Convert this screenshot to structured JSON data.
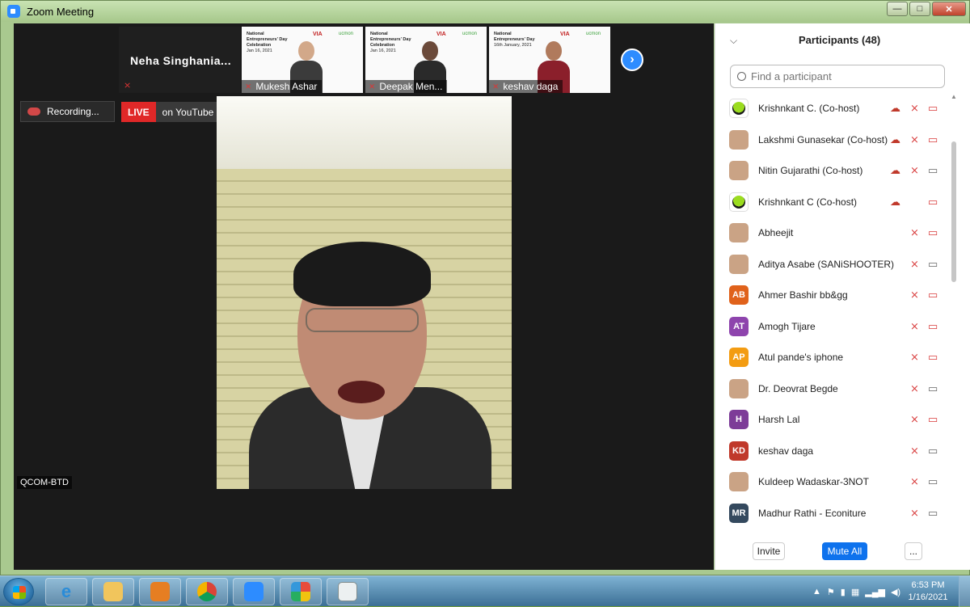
{
  "window": {
    "title": "Zoom Meeting",
    "min": "—",
    "max": "□",
    "close": "✕"
  },
  "gallery": {
    "name_tile": "Neha  Singhania...",
    "thumbs": [
      {
        "name": "Mukesh Ashar",
        "slide_title": "National Entrepreneurs' Day Celebration",
        "slide_date": "Jan 16, 2021",
        "logo": "VIA",
        "logo2": "ucmon"
      },
      {
        "name": "Deepak Men...",
        "slide_title": "National Entrepreneurs' Day Celebration",
        "slide_date": "Jan 16, 2021",
        "logo": "VIA",
        "logo2": "ucmon"
      },
      {
        "name": "keshav daga",
        "slide_title": "National Entrepreneurs' Day",
        "slide_date": "16th January, 2021",
        "logo": "VIA",
        "logo2": "ucmon"
      }
    ],
    "next": "›"
  },
  "recording": {
    "label": "Recording..."
  },
  "live": {
    "badge": "LIVE",
    "label": "on YouTube",
    "arrow": "▾"
  },
  "main_video": {
    "label": "QCOM-BTD"
  },
  "participants": {
    "title": "Participants (48)",
    "search_placeholder": "Find a participant",
    "list": [
      {
        "name": "Krishnkant C. (Co-host)",
        "avatar": "kr",
        "cloud": true,
        "mic": "off",
        "cam": "off"
      },
      {
        "name": "Lakshmi Gunasekar (Co-host)",
        "avatar": "img",
        "cloud": true,
        "mic": "off",
        "cam": "off"
      },
      {
        "name": "Nitin Gujarathi (Co-host)",
        "avatar": "img",
        "cloud": true,
        "mic": "off",
        "cam": "on"
      },
      {
        "name": "Krishnkant C (Co-host)",
        "avatar": "kr",
        "cloud": true,
        "mic": "none",
        "cam": "off"
      },
      {
        "name": "Abheejit",
        "avatar": "img",
        "cloud": false,
        "mic": "off",
        "cam": "off"
      },
      {
        "name": "Aditya Asabe (SANiSHOOTER)",
        "avatar": "img",
        "cloud": false,
        "mic": "off",
        "cam": "on"
      },
      {
        "name": "Ahmer Bashir bb&gg",
        "initials": "AB",
        "color": "#e0621b",
        "cloud": false,
        "mic": "off",
        "cam": "off"
      },
      {
        "name": "Amogh Tijare",
        "initials": "AT",
        "color": "#8e44ad",
        "cloud": false,
        "mic": "off",
        "cam": "off"
      },
      {
        "name": "Atul pande's iphone",
        "initials": "AP",
        "color": "#f39c12",
        "cloud": false,
        "mic": "off",
        "cam": "off"
      },
      {
        "name": "Dr. Deovrat Begde",
        "avatar": "img",
        "cloud": false,
        "mic": "off",
        "cam": "on"
      },
      {
        "name": "Harsh Lal",
        "initials": "H",
        "color": "#7d3c98",
        "cloud": false,
        "mic": "off",
        "cam": "off"
      },
      {
        "name": "keshav daga",
        "initials": "KD",
        "color": "#c0392b",
        "cloud": false,
        "mic": "off",
        "cam": "on"
      },
      {
        "name": "Kuldeep Wadaskar-3NOT",
        "avatar": "img",
        "cloud": false,
        "mic": "off",
        "cam": "on"
      },
      {
        "name": "Madhur Rathi - Econiture",
        "initials": "MR",
        "color": "#34495e",
        "cloud": false,
        "mic": "off",
        "cam": "on"
      }
    ],
    "footer": {
      "invite": "Invite",
      "mute_all": "Mute All",
      "more": "..."
    }
  },
  "taskbar": {
    "apps": [
      "internet-explorer",
      "file-explorer",
      "media-player",
      "chrome",
      "zoom",
      "paint",
      "document"
    ],
    "time": "6:53 PM",
    "date": "1/16/2021"
  },
  "colors": {
    "zoom_blue": "#2d8cff",
    "live_red": "#e02828",
    "muted_red": "#d83b3b"
  }
}
